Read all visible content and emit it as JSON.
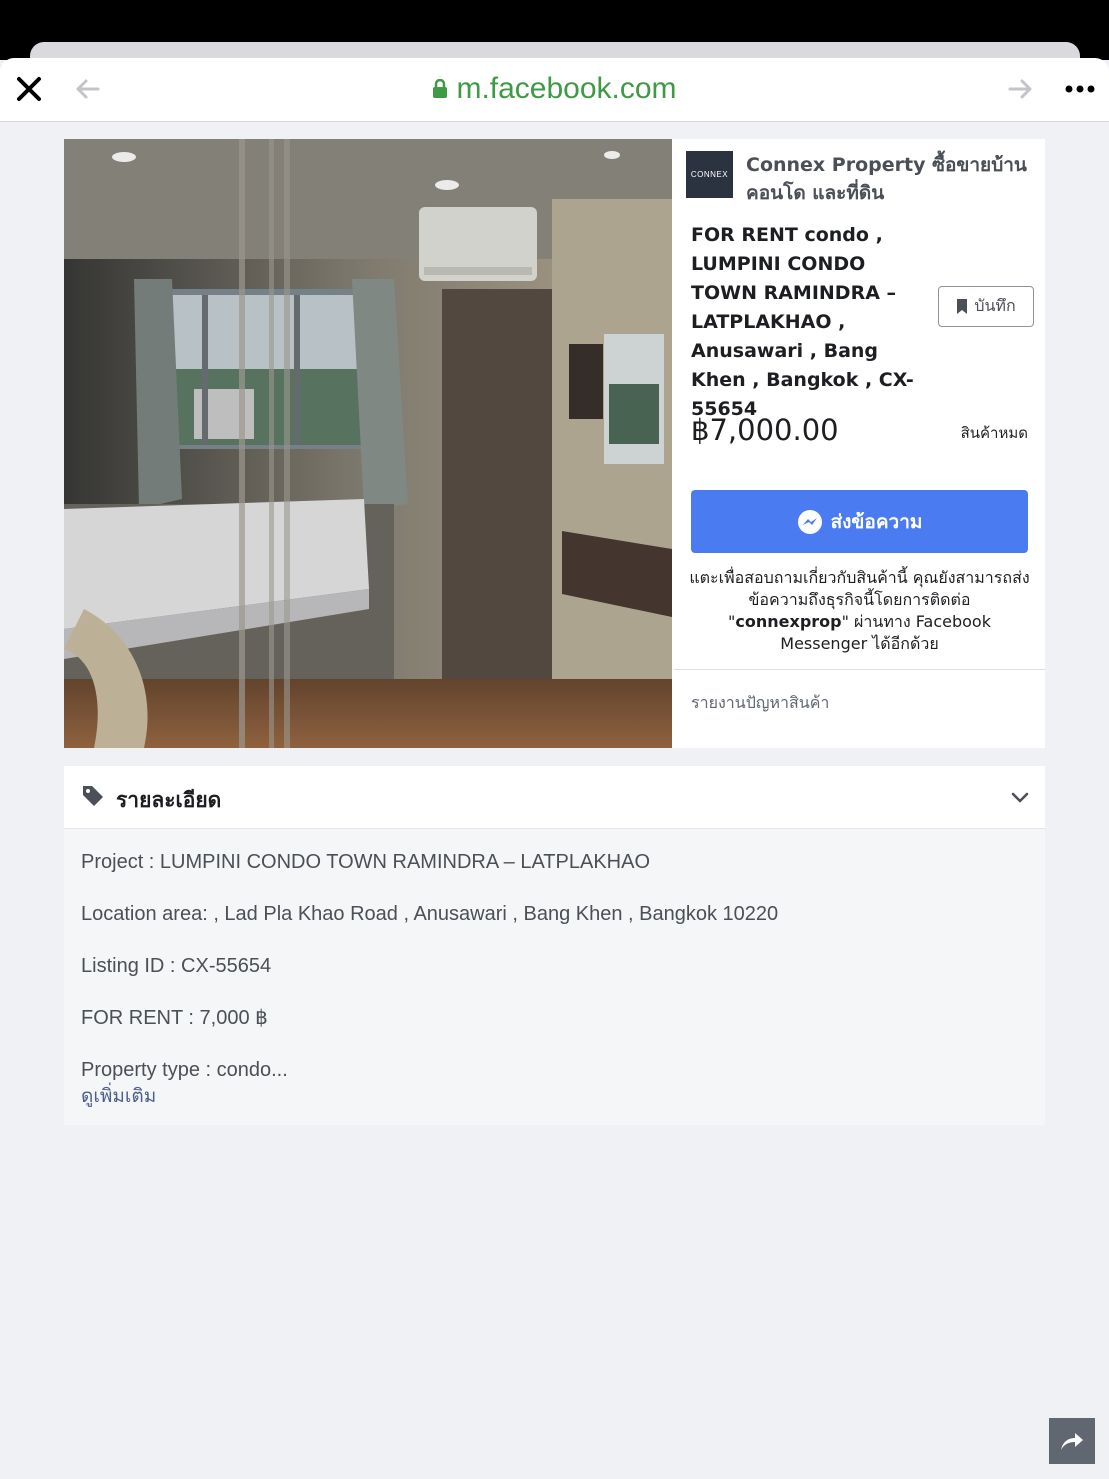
{
  "browser": {
    "url": "m.facebook.com"
  },
  "listing": {
    "seller_logo_text": "CONNEX",
    "seller_name": "Connex Property ซื้อขายบ้าน คอนโด และที่ดิน",
    "title": "FOR RENT condo , LUMPINI CONDO TOWN RAMINDRA – LATPLAKHAO , Anusawari , Bang Khen , Bangkok , CX-55654",
    "save_label": "บันทึก",
    "price": "฿7,000.00",
    "status": "สินค้าหมด",
    "message_button_label": "ส่งข้อความ",
    "note_before": "แตะเพื่อสอบถามเกี่ยวกับสินค้านี้ คุณยังสามารถส่งข้อความถึงธุรกิจนี้โดยการติดต่อ \"",
    "note_handle": "connexprop",
    "note_after": "\" ผ่านทาง Facebook Messenger ได้อีกด้วย",
    "report_label": "รายงานปัญหาสินค้า"
  },
  "details": {
    "title": "รายละเอียด",
    "lines": [
      "Project : LUMPINI CONDO TOWN RAMINDRA – LATPLAKHAO",
      "Location area: , Lad Pla Khao Road , Anusawari , Bang Khen , Bangkok 10220",
      "Listing ID : CX-55654",
      "FOR RENT : 7,000 ฿",
      "Property type : condo..."
    ],
    "see_more": "ดูเพิ่มเติม"
  },
  "icons": {
    "close": "close-icon",
    "back": "arrow-left-icon",
    "forward": "arrow-right-icon",
    "more": "more-icon",
    "lock": "lock-icon",
    "bookmark": "bookmark-icon",
    "messenger": "messenger-icon",
    "tag": "tag-icon",
    "chevron": "chevron-down-icon",
    "share": "share-icon"
  },
  "colors": {
    "url_green": "#3e9a44",
    "messenger_blue": "#4a7bf0",
    "link": "#4b5e8f"
  }
}
